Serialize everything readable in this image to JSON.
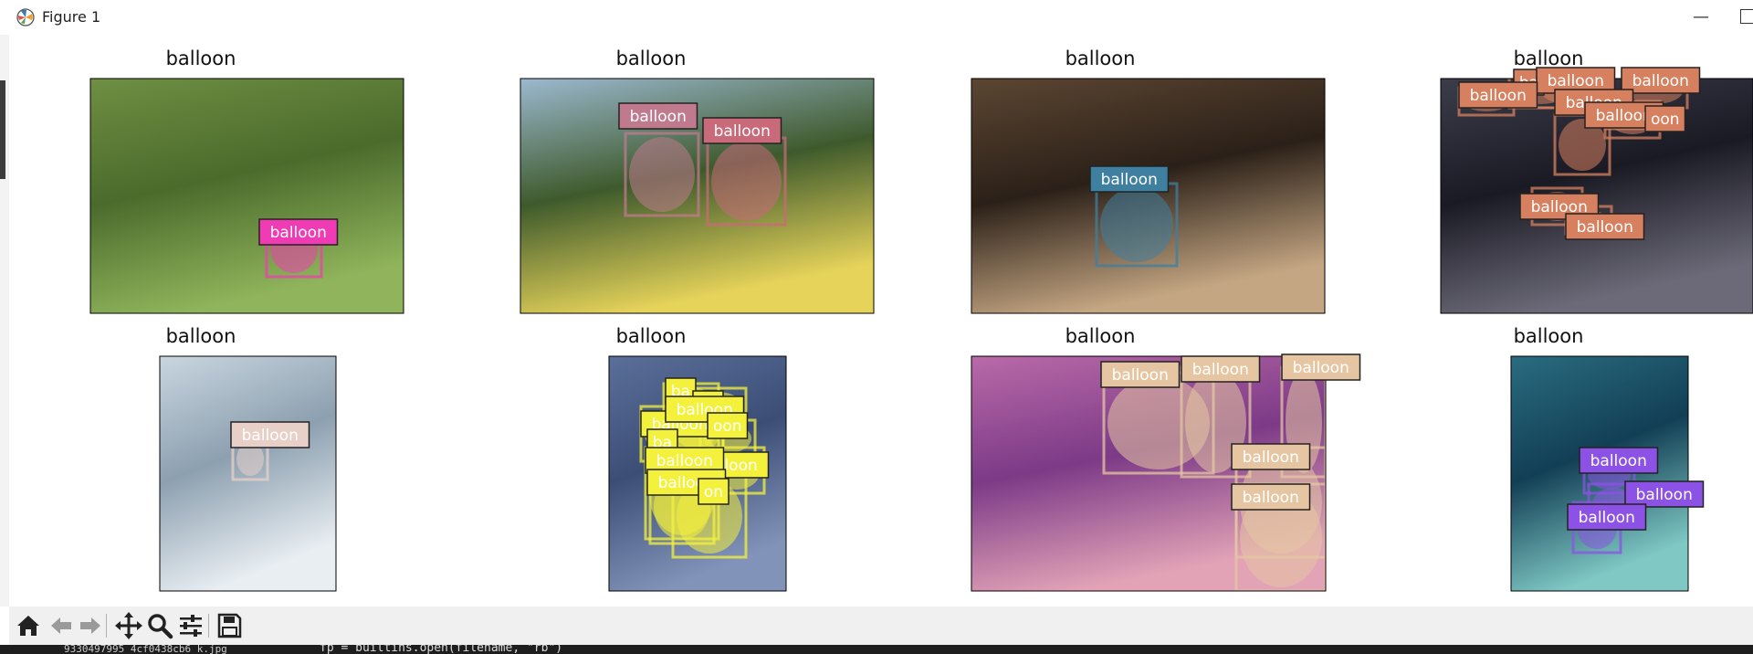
{
  "window": {
    "title": "Figure 1",
    "minimize_label": "—"
  },
  "subplots": [
    {
      "title": "balloon",
      "palette": [
        "#6f8f43",
        "#4b6b2c",
        "#8fb45b"
      ],
      "boxes": [
        {
          "label": "balloon",
          "color": "#f03cb4"
        }
      ]
    },
    {
      "title": "balloon",
      "palette": [
        "#9cb9d0",
        "#3e5a2c",
        "#e6d35a"
      ],
      "boxes": [
        {
          "label": "balloon",
          "color": "#c07a8e"
        },
        {
          "label": "balloon",
          "color": "#c96a7a"
        }
      ]
    },
    {
      "title": "balloon",
      "palette": [
        "#5c4632",
        "#2b2018",
        "#c4a682"
      ],
      "boxes": [
        {
          "label": "balloon",
          "color": "#3f7fa0"
        }
      ]
    },
    {
      "title": "balloon",
      "palette": [
        "#3b3d4a",
        "#1a1a24",
        "#6c6a78"
      ],
      "boxes": [
        {
          "label": "ba",
          "color": "#d6805f"
        },
        {
          "label": "balloon",
          "color": "#d6805f"
        },
        {
          "label": "balloon",
          "color": "#d6805f"
        },
        {
          "label": "balloon",
          "color": "#d6805f"
        },
        {
          "label": "balloon",
          "color": "#d6805f"
        },
        {
          "label": "balloon",
          "color": "#d6805f"
        },
        {
          "label": "oon",
          "color": "#d6805f"
        },
        {
          "label": "balloon",
          "color": "#d6805f"
        },
        {
          "label": "balloon",
          "color": "#d6805f"
        }
      ]
    },
    {
      "title": "balloon",
      "palette": [
        "#c9d6e0",
        "#8da0b0",
        "#e8eef2"
      ],
      "boxes": [
        {
          "label": "balloon",
          "color": "#e8d0c8"
        }
      ]
    },
    {
      "title": "balloon",
      "palette": [
        "#5a6f99",
        "#3c4e76",
        "#8193b8"
      ],
      "boxes": [
        {
          "label": "ba",
          "color": "#f4f13c"
        },
        {
          "label": "on",
          "color": "#f4f13c"
        },
        {
          "label": "balloon",
          "color": "#f4f13c"
        },
        {
          "label": "ba",
          "color": "#f4f13c"
        },
        {
          "label": "balloon",
          "color": "#f4f13c"
        },
        {
          "label": "oon",
          "color": "#f4f13c"
        },
        {
          "label": "lloon",
          "color": "#f4f13c"
        },
        {
          "label": "balloon",
          "color": "#f4f13c"
        },
        {
          "label": "balloon",
          "color": "#f4f13c"
        },
        {
          "label": "on",
          "color": "#f4f13c"
        }
      ]
    },
    {
      "title": "balloon",
      "palette": [
        "#b96aa8",
        "#7c3a87",
        "#e2a3b7"
      ],
      "boxes": [
        {
          "label": "balloon",
          "color": "#e6c6a2"
        },
        {
          "label": "balloon",
          "color": "#e6c6a2"
        },
        {
          "label": "balloon",
          "color": "#e6c6a2"
        },
        {
          "label": "balloon",
          "color": "#e6c6a2"
        },
        {
          "label": "balloon",
          "color": "#e6c6a2"
        }
      ]
    },
    {
      "title": "balloon",
      "palette": [
        "#2a6c80",
        "#123f55",
        "#7fc8c4"
      ],
      "boxes": [
        {
          "label": "balloon",
          "color": "#8c52e6"
        },
        {
          "label": "balloon",
          "color": "#8c52e6"
        },
        {
          "label": "balloon",
          "color": "#8c52e6"
        }
      ]
    }
  ],
  "toolbar": {
    "buttons": [
      {
        "name": "home-button",
        "icon": "home-icon"
      },
      {
        "name": "back-button",
        "icon": "arrow-left-icon"
      },
      {
        "name": "forward-button",
        "icon": "arrow-right-icon"
      },
      {
        "name": "pan-button",
        "icon": "move-icon"
      },
      {
        "name": "zoom-button",
        "icon": "magnifier-icon"
      },
      {
        "name": "configure-subplots-button",
        "icon": "sliders-icon"
      },
      {
        "name": "save-button",
        "icon": "floppy-disk-icon"
      }
    ]
  },
  "statusbar": {
    "file_text": "9330497995_4cf0438cb6_k.jpg",
    "code_text": "fp = builtins.open(filename, \"rb\")"
  }
}
